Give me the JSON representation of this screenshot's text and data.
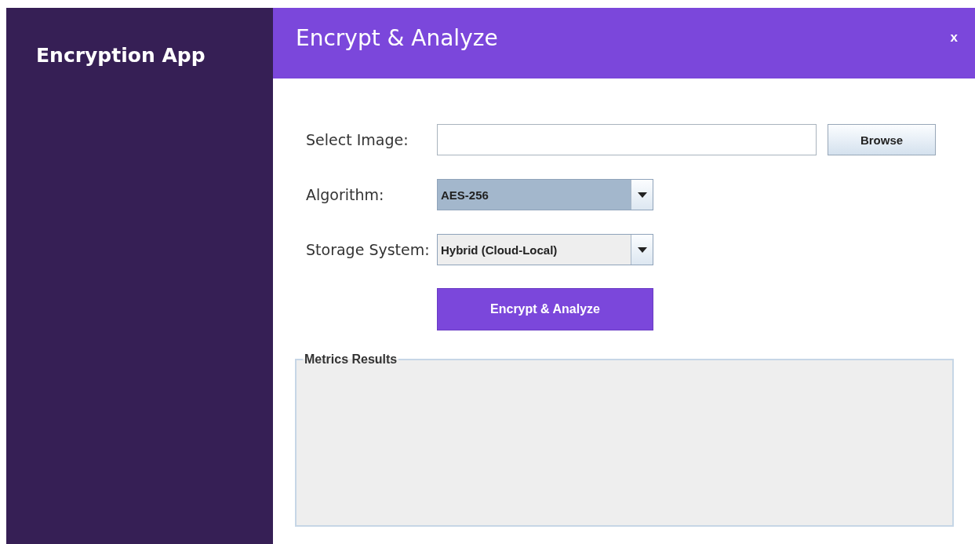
{
  "sidebar": {
    "title": "Encryption App"
  },
  "header": {
    "title": "Encrypt & Analyze",
    "close": "x"
  },
  "form": {
    "image": {
      "label": "Select Image:",
      "button": "Browse"
    },
    "dropdowns": [
      {
        "label": "Algorithm:",
        "value": "AES-256",
        "focused": true
      },
      {
        "label": "Storage System:",
        "value": "Hybrid (Cloud-Local)",
        "focused": false
      }
    ],
    "submit": "Encrypt & Analyze"
  },
  "results": {
    "title": "Metrics Results"
  }
}
